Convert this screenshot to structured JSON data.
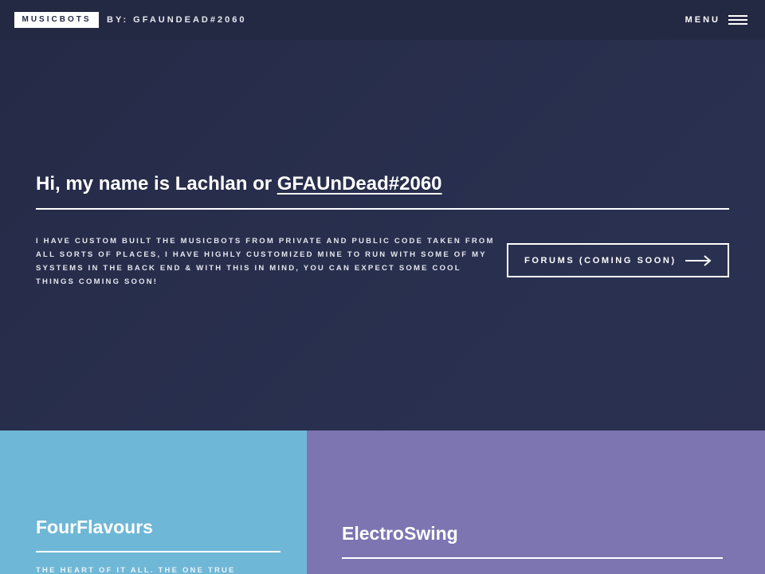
{
  "header": {
    "logo_text": "MUSICBOTS",
    "byline": "BY: GFAUNDEAD#2060",
    "menu_label": "MENU",
    "menu_icon": "hamburger-icon"
  },
  "hero": {
    "title_prefix": "Hi, my name is Lachlan or ",
    "title_link": "GFAUnDead#2060",
    "description": "I have custom built the musicbots from private and public code taken from all sorts of places, I have highly customized mine to run with some of my systems in the back end & with this in mind, you can expect some cool things coming soon!",
    "button_label": "FORUMS (COMING SOON)",
    "button_icon": "arrow-right-icon"
  },
  "tiles": [
    {
      "title": "FourFlavours",
      "description": "THE HEART OF IT ALL. THE ONE TRUE",
      "color": "#6fb7d6"
    },
    {
      "title": "ElectroSwing",
      "description": "",
      "color": "#7d75b2"
    }
  ],
  "colors": {
    "background": "#242943",
    "accent_blue": "#6fb7d6",
    "accent_purple": "#7d75b2",
    "text": "#ffffff"
  }
}
